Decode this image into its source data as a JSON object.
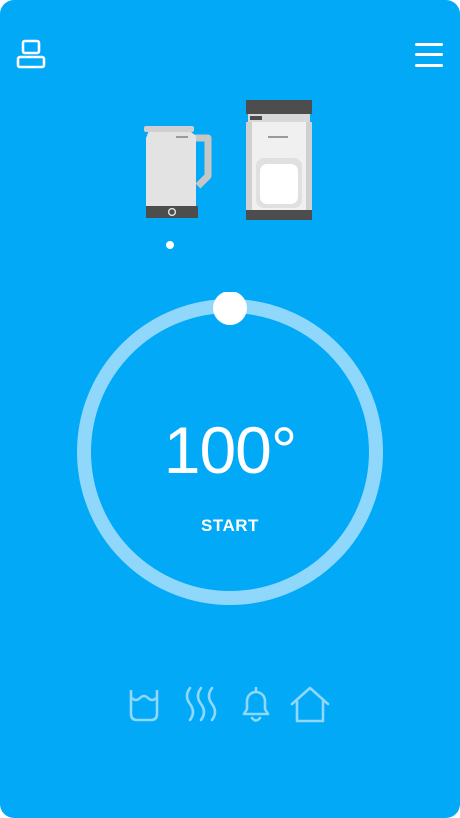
{
  "header": {
    "user_icon": "user-device-icon",
    "menu_icon": "hamburger-menu-icon"
  },
  "appliances": [
    {
      "name": "kettle",
      "icon": "kettle-icon"
    },
    {
      "name": "coffee-machine",
      "icon": "coffee-machine-icon"
    }
  ],
  "pager": {
    "active_index": 0,
    "count": 1
  },
  "dial": {
    "temperature": "100°",
    "action_label": "START",
    "colors": {
      "ring": "#8FD8FB",
      "knob": "#FFFFFF"
    }
  },
  "bottom_nav": [
    {
      "name": "water-level",
      "icon": "water-cup-icon"
    },
    {
      "name": "heat",
      "icon": "heat-waves-icon"
    },
    {
      "name": "alarm",
      "icon": "bell-icon"
    },
    {
      "name": "home",
      "icon": "home-icon"
    }
  ],
  "colors": {
    "background": "#02A9F7",
    "nav_icon": "#8FD8FB",
    "foreground": "#FFFFFF"
  }
}
